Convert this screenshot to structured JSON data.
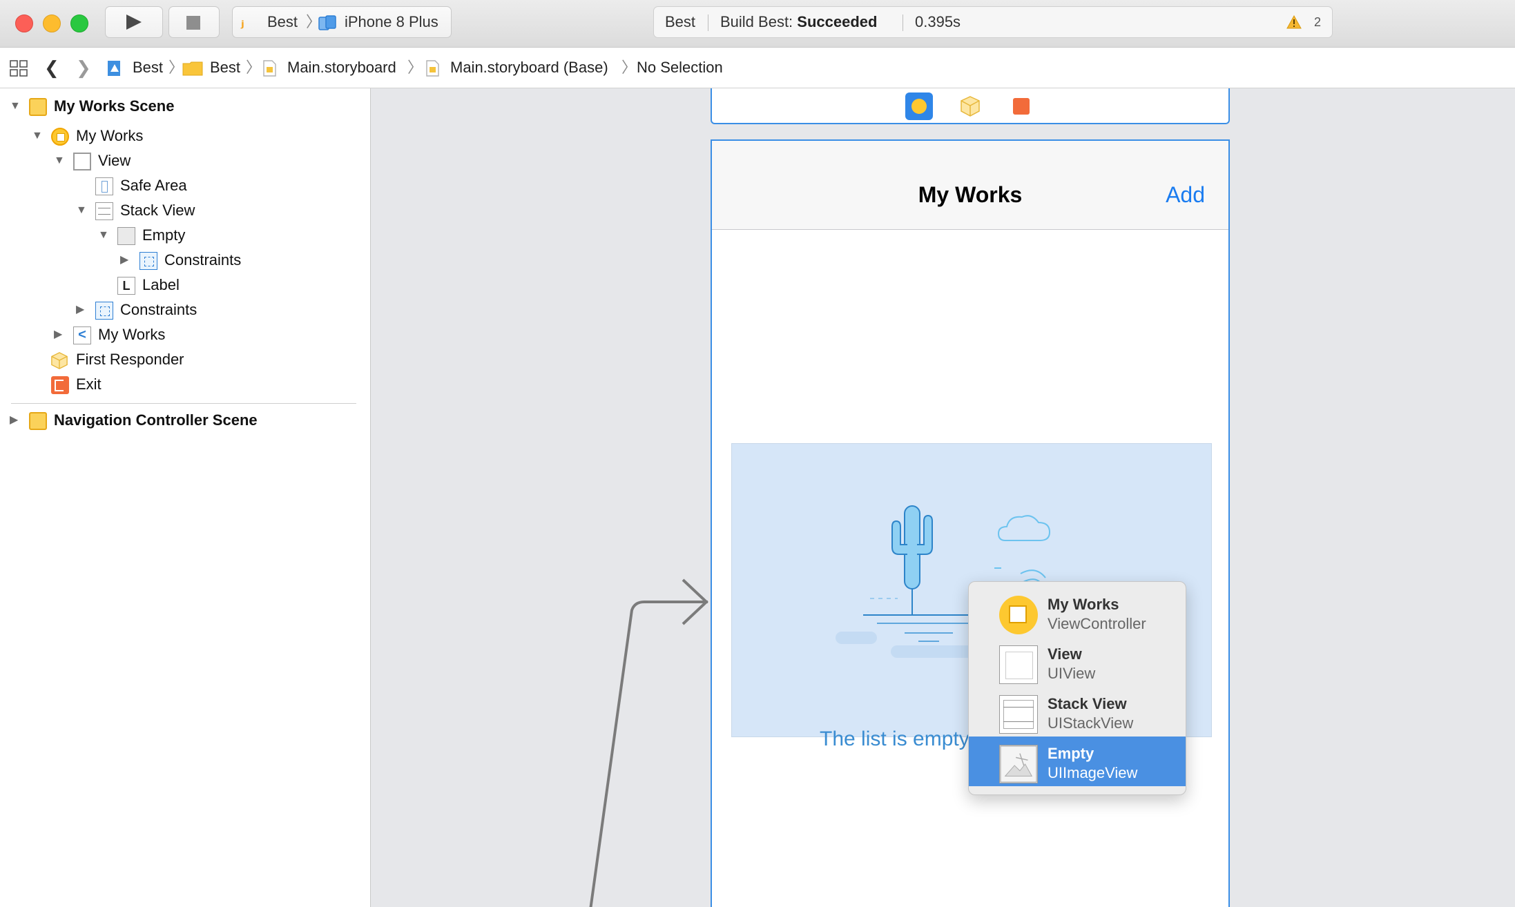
{
  "toolbar": {
    "scheme_name": "Best",
    "device_name": "iPhone 8 Plus",
    "activity_project": "Best",
    "activity_status_prefix": "Build Best: ",
    "activity_status": "Succeeded",
    "activity_time": "0.395s",
    "warning_count": "2"
  },
  "jumpbar": {
    "crumbs": [
      "Best",
      "Best",
      "Main.storyboard",
      "Main.storyboard (Base)",
      "No Selection"
    ]
  },
  "navigator": {
    "items": [
      {
        "label": "My Works Scene",
        "icon": "scene-icon"
      },
      {
        "label": "My Works",
        "icon": "view-controller-icon"
      },
      {
        "label": "View",
        "icon": "view-icon"
      },
      {
        "label": "Safe Area",
        "icon": "safe-area-icon"
      },
      {
        "label": "Stack View",
        "icon": "stack-view-icon"
      },
      {
        "label": "Empty",
        "icon": "image-view-icon"
      },
      {
        "label": "Constraints",
        "icon": "constraints-icon"
      },
      {
        "label": "Label",
        "icon": "label-icon",
        "icon_glyph": "L"
      },
      {
        "label": "Constraints",
        "icon": "constraints-icon"
      },
      {
        "label": "My Works",
        "icon": "navigation-item-icon",
        "icon_glyph": "<"
      },
      {
        "label": "First Responder",
        "icon": "first-responder-icon"
      },
      {
        "label": "Exit",
        "icon": "exit-icon"
      },
      {
        "label": "Navigation Controller Scene",
        "icon": "scene-icon"
      }
    ]
  },
  "canvas": {
    "nav_title": "My Works",
    "nav_button": "Add",
    "empty_label": "The list is empty"
  },
  "popup": {
    "items": [
      {
        "name": "My Works",
        "type": "ViewController",
        "icon": "view-controller-icon",
        "selected": false
      },
      {
        "name": "View",
        "type": "UIView",
        "icon": "view-icon",
        "selected": false
      },
      {
        "name": "Stack View",
        "type": "UIStackView",
        "icon": "stack-view-icon",
        "selected": false
      },
      {
        "name": "Empty",
        "type": "UIImageView",
        "icon": "image-view-icon",
        "selected": true
      }
    ]
  },
  "colors": {
    "accent": "#3a8ee6",
    "selection": "#4a90e2",
    "link": "#1a7cf0",
    "warning": "#f5a623"
  }
}
